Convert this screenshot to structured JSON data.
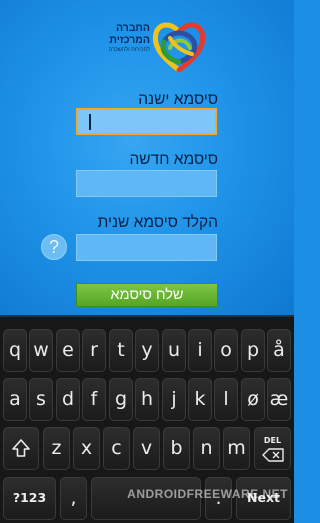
{
  "logo": {
    "line1": "החברה",
    "line2": "המרכזית",
    "line3": "לחכירות ולהשכרה",
    "icon": "heart-knot-logo-icon",
    "colors": [
      "#f0c21a",
      "#2d9b3a",
      "#e53a2e",
      "#2c4fa3",
      "#8fc83e"
    ]
  },
  "form": {
    "old_password_label": "סיסמא ישנה",
    "old_password_value": "",
    "new_password_label": "סיסמא חדשה",
    "new_password_value": "",
    "confirm_password_label": "הקלד סיסמא שנית",
    "confirm_password_value": "",
    "help_glyph": "?",
    "send_label": "שלח סיסמא"
  },
  "keyboard": {
    "row1": [
      "q",
      "w",
      "e",
      "r",
      "t",
      "y",
      "u",
      "i",
      "o",
      "p",
      "å"
    ],
    "row2": [
      "a",
      "s",
      "d",
      "f",
      "g",
      "h",
      "j",
      "k",
      "l",
      "ø",
      "æ"
    ],
    "row3": [
      "z",
      "x",
      "c",
      "v",
      "b",
      "n",
      "m"
    ],
    "del_label": "DEL",
    "symbols_label": "?123",
    "comma_label": ",",
    "period_label": ".",
    "next_label": "Next"
  },
  "watermark": "ANDROIDFREEWARE.NET",
  "colors": {
    "background": "#1e93e8",
    "send_button": "#6bb836",
    "focus_border": "#f4a82a",
    "keyboard": "#171717"
  }
}
